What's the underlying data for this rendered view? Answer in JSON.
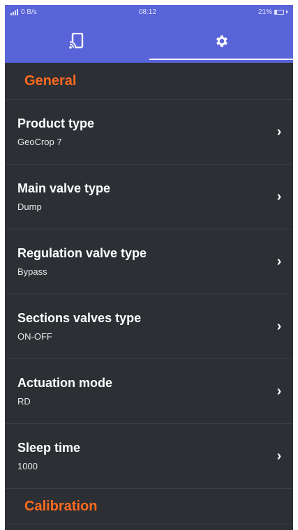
{
  "status_bar": {
    "network": "0 B/s",
    "time": "08:12",
    "battery": "21%"
  },
  "tabs": [
    {
      "icon": "device-cast-icon",
      "active": false
    },
    {
      "icon": "gear-icon",
      "active": true
    }
  ],
  "sections": {
    "general_title": "General",
    "calibration_title": "Calibration"
  },
  "settings": [
    {
      "title": "Product type",
      "value": "GeoCrop 7"
    },
    {
      "title": "Main valve type",
      "value": "Dump"
    },
    {
      "title": "Regulation valve type",
      "value": "Bypass"
    },
    {
      "title": "Sections valves type",
      "value": "ON-OFF"
    },
    {
      "title": "Actuation mode",
      "value": "RD"
    },
    {
      "title": "Sleep time",
      "value": "1000"
    }
  ],
  "colors": {
    "header": "#5964d8",
    "background": "#2c2f33",
    "accent": "#ff6a1f"
  }
}
